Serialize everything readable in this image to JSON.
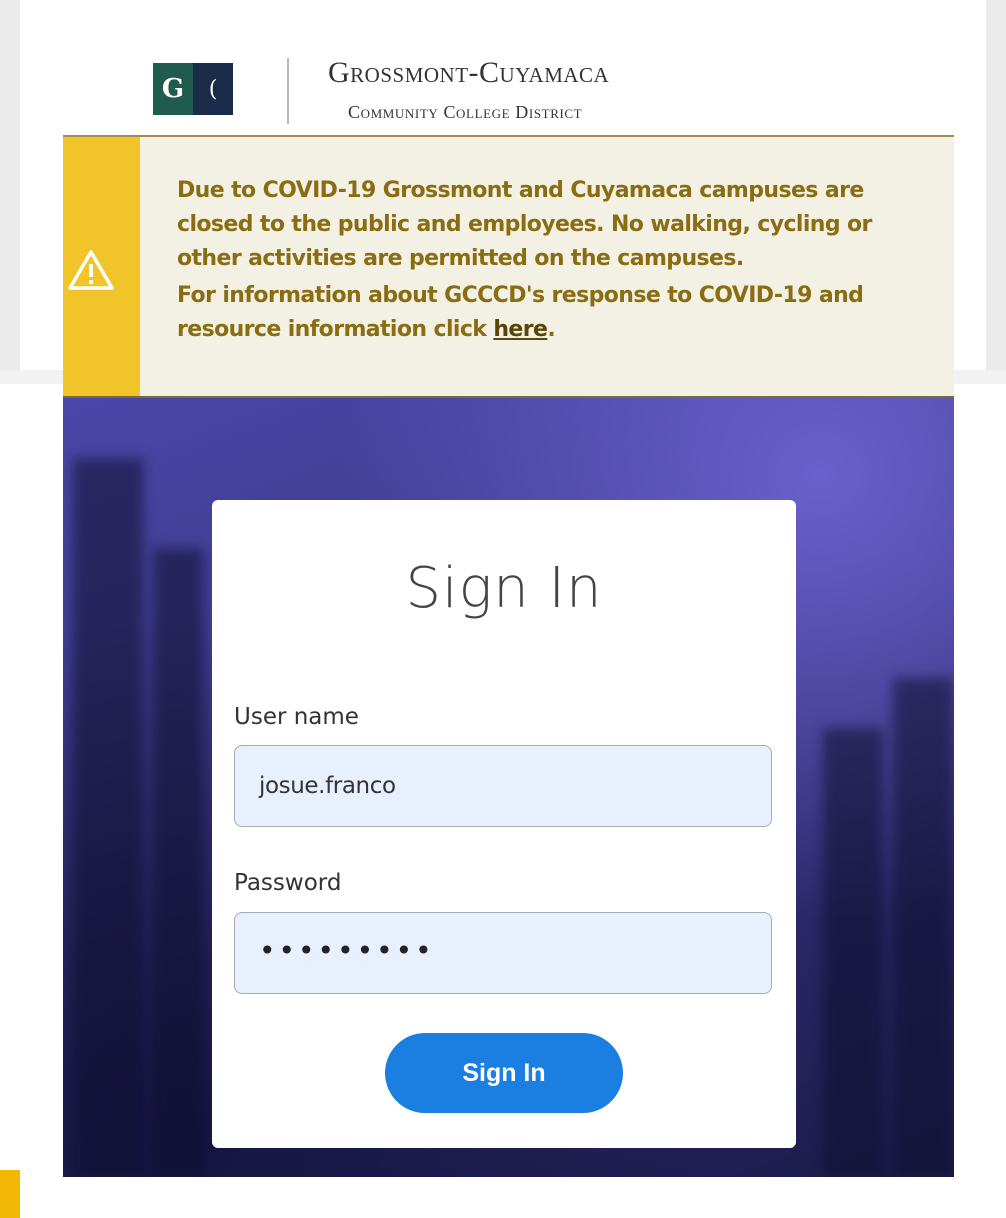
{
  "header": {
    "logo_letter": "G",
    "logo_symbol": "(",
    "title": "Grossmont-Cuyamaca",
    "subtitle": "Community College District"
  },
  "alert": {
    "icon": "warning-triangle-icon",
    "paragraph1": "Due to COVID-19 Grossmont and Cuyamaca campuses are closed to the public and employees. No walking, cycling or other activities are permitted on the campuses.",
    "paragraph2_prefix": "For information about GCCCD's response to COVID-19 and resource information click ",
    "link_text": "here",
    "paragraph2_suffix": "."
  },
  "signin": {
    "title": "Sign In",
    "username_label": "User name",
    "username_value": "josue.franco",
    "password_label": "Password",
    "password_value": "•••••••••",
    "button_label": "Sign In"
  },
  "colors": {
    "alert_stripe": "#f1c52a",
    "alert_text": "#8a6d12",
    "button": "#1a7fe0",
    "input_bg": "#e8f0fe"
  }
}
